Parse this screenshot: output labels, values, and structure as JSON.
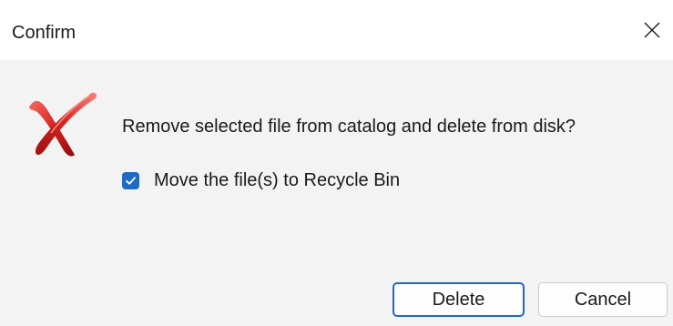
{
  "window": {
    "title": "Confirm",
    "close_icon": "close-icon"
  },
  "dialog": {
    "icon": "error-x-icon",
    "message": "Remove selected file from catalog and delete from disk?",
    "checkbox": {
      "label": "Move the file(s) to Recycle Bin",
      "checked": true
    },
    "buttons": {
      "delete_label": "Delete",
      "cancel_label": "Cancel"
    }
  },
  "colors": {
    "accent": "#1e6bc1",
    "icon_red": "#d32222"
  }
}
